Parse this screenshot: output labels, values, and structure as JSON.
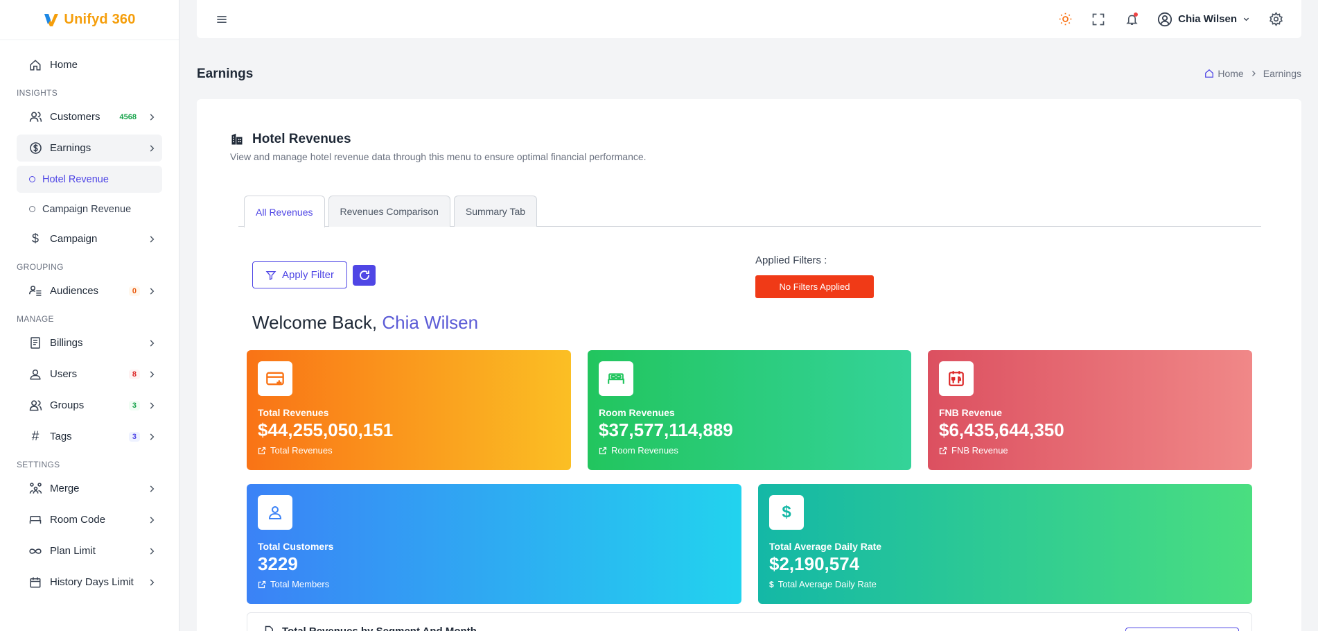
{
  "app": {
    "name": "Unifyd 360"
  },
  "sidebar": {
    "home": "Home",
    "sections": {
      "insights": "INSIGHTS",
      "grouping": "GROUPING",
      "manage": "MANAGE",
      "settings": "SETTINGS"
    },
    "customers": {
      "label": "Customers",
      "badge": "4568"
    },
    "earnings": {
      "label": "Earnings"
    },
    "hotel_revenue": "Hotel Revenue",
    "campaign_revenue": "Campaign Revenue",
    "campaign": "Campaign",
    "audiences": {
      "label": "Audiences",
      "badge": "0"
    },
    "billings": "Billings",
    "users": {
      "label": "Users",
      "badge": "8"
    },
    "groups": {
      "label": "Groups",
      "badge": "3"
    },
    "tags": {
      "label": "Tags",
      "badge": "3"
    },
    "merge": "Merge",
    "room_code": "Room Code",
    "plan_limit": "Plan Limit",
    "history_days_limit": "History Days Limit"
  },
  "topbar": {
    "user_name": "Chia Wilsen"
  },
  "page": {
    "title": "Earnings",
    "breadcrumb": {
      "home": "Home",
      "current": "Earnings"
    }
  },
  "card": {
    "title": "Hotel Revenues",
    "subtitle": "View and manage hotel revenue data through this menu to ensure optimal financial performance.",
    "tabs": [
      "All Revenues",
      "Revenues Comparison",
      "Summary Tab"
    ],
    "apply_filter": "Apply Filter",
    "applied_filters_label": "Applied Filters :",
    "no_filters": "No Filters Applied",
    "welcome_prefix": "Welcome Back,",
    "welcome_name": "Chia Wilsen",
    "bottom_title": "Total Revenues by Segment And Month"
  },
  "stats": [
    {
      "label": "Total Revenues",
      "value": "$44,255,050,151",
      "foot": "Total Revenues",
      "icon": "credit-card-plus-icon",
      "color": "#f97316"
    },
    {
      "label": "Room Revenues",
      "value": "$37,577,114,889",
      "foot": "Room Revenues",
      "icon": "bed-icon",
      "color": "#22c55e"
    },
    {
      "label": "FNB Revenue",
      "value": "$6,435,644,350",
      "foot": "FNB Revenue",
      "icon": "calendar-utensils-icon",
      "color": "#dc5060"
    },
    {
      "label": "Total Customers",
      "value": "3229",
      "foot": "Total Members",
      "icon": "user-icon",
      "color": "#3b82f6"
    },
    {
      "label": "Total Average Daily Rate",
      "value": "$2,190,574",
      "foot": "Total Average Daily Rate",
      "icon": "dollar-icon",
      "color": "#14b8a6"
    }
  ]
}
